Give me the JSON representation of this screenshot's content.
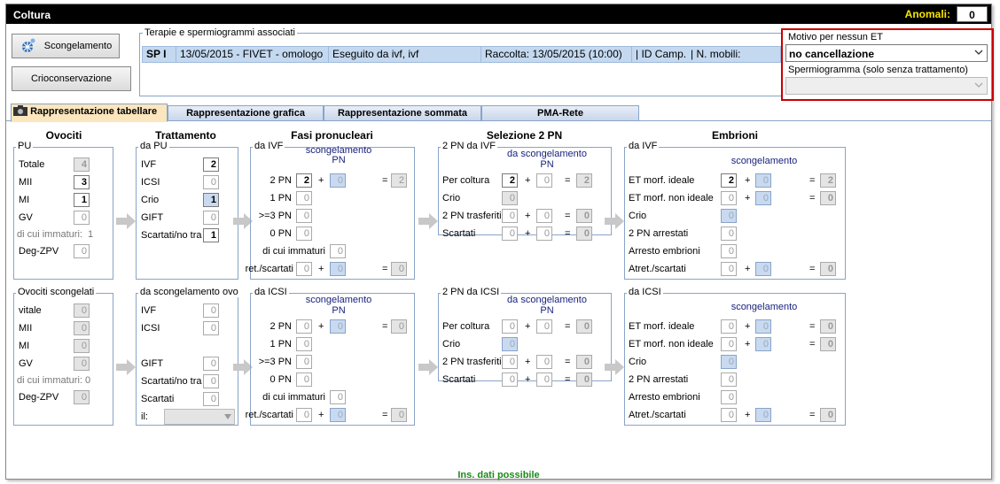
{
  "window": {
    "title": "Coltura",
    "anomali_label": "Anomali:",
    "anomali_value": "0"
  },
  "buttons": {
    "scongelamento": "Scongelamento",
    "crioconservazione": "Crioconservazione"
  },
  "terapie": {
    "legend": "Terapie e spermiogrammi associati",
    "row": [
      "SP I",
      "13/05/2015 - FIVET - omologo",
      "Eseguito da ivf, ivf",
      "Raccolta: 13/05/2015 (10:00)",
      "| ID Camp.:",
      "| N. mobili:"
    ]
  },
  "motivo": {
    "label": "Motivo per nessun ET",
    "value": "no cancellazione",
    "sperm_label": "Spermiogramma (solo senza trattamento)",
    "sperm_value": ""
  },
  "tabs": [
    "Rappresentazione tabellare",
    "Rappresentazione grafica",
    "Rappresentazione sommata",
    "PMA-Rete"
  ],
  "headers": {
    "ovociti": "Ovociti",
    "trattamento": "Trattamento",
    "fasi": "Fasi pronucleari",
    "selezione": "Selezione 2 PN",
    "embrioni": "Embrioni"
  },
  "top": {
    "pu": {
      "title": "PU",
      "rows": [
        {
          "l": "Totale",
          "v": "4"
        },
        {
          "l": "MII",
          "v": "3"
        },
        {
          "l": "MI",
          "v": "1"
        },
        {
          "l": "GV",
          "v": "0"
        }
      ],
      "immaturi": "di cui immaturi:",
      "immaturi_v": "1",
      "deg": "Deg-ZPV",
      "deg_v": "0"
    },
    "tratt": {
      "title": "da PU",
      "rows": [
        {
          "l": "IVF",
          "v": "2"
        },
        {
          "l": "ICSI",
          "v": "0"
        },
        {
          "l": "Crio",
          "v": "1"
        },
        {
          "l": "GIFT",
          "v": "0"
        },
        {
          "l": "Scartati/no tra",
          "v": "1"
        }
      ]
    },
    "fasi": {
      "title": "da IVF",
      "sub": "scongelamento",
      "sub2": "PN",
      "rows": [
        {
          "l": "2 PN",
          "v": "2",
          "s": "0",
          "t": "2"
        },
        {
          "l": "1 PN",
          "v": "0"
        },
        {
          "l": ">=3 PN",
          "v": "0"
        },
        {
          "l": "0 PN",
          "v": "0"
        }
      ],
      "imm": "di cui immaturi",
      "imm_v": "0",
      "atr": "Atret./scartati",
      "atr_v": "0",
      "atr_s": "0",
      "atr_t": "0"
    },
    "sel": {
      "title": "2 PN da IVF",
      "sub": "da scongelamento",
      "sub2": "PN",
      "rows": [
        {
          "l": "Per coltura",
          "v": "2",
          "s": "0",
          "t": "2"
        },
        {
          "l": "Crio",
          "v": "0"
        },
        {
          "l": "2 PN trasferiti",
          "v": "0",
          "s": "0",
          "t": "0"
        },
        {
          "l": "Scartati",
          "v": "0",
          "s": "0",
          "t": "0"
        }
      ]
    },
    "emb": {
      "title": "da IVF",
      "sub": "scongelamento",
      "rows": [
        {
          "l": "ET morf. ideale",
          "v": "2",
          "s": "0",
          "t": "2"
        },
        {
          "l": "ET morf. non ideale",
          "v": "0",
          "s": "0",
          "t": "0"
        },
        {
          "l": "Crio",
          "v": "0"
        },
        {
          "l": "2 PN arrestati",
          "v": "0"
        },
        {
          "l": "Arresto embrioni",
          "v": "0"
        },
        {
          "l": "Atret./scartati",
          "v": "0",
          "s": "0",
          "t": "0"
        }
      ]
    }
  },
  "bottom": {
    "pu": {
      "title": "Ovociti scongelati",
      "rows": [
        {
          "l": "vitale",
          "v": "0"
        },
        {
          "l": "MII",
          "v": "0"
        },
        {
          "l": "MI",
          "v": "0"
        },
        {
          "l": "GV",
          "v": "0"
        }
      ],
      "immaturi": "di cui immaturi: 0",
      "deg": "Deg-ZPV",
      "deg_v": "0"
    },
    "tratt": {
      "title": "da scongelamento ovo",
      "rows": [
        {
          "l": "IVF",
          "v": "0"
        },
        {
          "l": "ICSI",
          "v": "0"
        },
        {
          "l": "GIFT",
          "v": "0"
        },
        {
          "l": "Scartati/no tra",
          "v": "0"
        },
        {
          "l": "Scartati",
          "v": "0"
        }
      ],
      "il": "il:"
    },
    "fasi": {
      "title": "da ICSI",
      "sub": "scongelamento",
      "sub2": "PN",
      "rows": [
        {
          "l": "2 PN",
          "v": "0",
          "s": "0",
          "t": "0"
        },
        {
          "l": "1 PN",
          "v": "0"
        },
        {
          "l": ">=3 PN",
          "v": "0"
        },
        {
          "l": "0 PN",
          "v": "0"
        }
      ],
      "imm": "di cui immaturi",
      "imm_v": "0",
      "atr": "Atret./scartati",
      "atr_v": "0",
      "atr_s": "0",
      "atr_t": "0"
    },
    "sel": {
      "title": "2 PN da ICSI",
      "sub": "da scongelamento",
      "sub2": "PN",
      "rows": [
        {
          "l": "Per coltura",
          "v": "0",
          "s": "0",
          "t": "0"
        },
        {
          "l": "Crio",
          "v": "0"
        },
        {
          "l": "2 PN trasferiti",
          "v": "0",
          "s": "0",
          "t": "0"
        },
        {
          "l": "Scartati",
          "v": "0",
          "s": "0",
          "t": "0"
        }
      ]
    },
    "emb": {
      "title": "da ICSI",
      "sub": "scongelamento",
      "rows": [
        {
          "l": "ET morf. ideale",
          "v": "0",
          "s": "0",
          "t": "0"
        },
        {
          "l": "ET morf. non ideale",
          "v": "0",
          "s": "0",
          "t": "0"
        },
        {
          "l": "Crio",
          "v": "0"
        },
        {
          "l": "2 PN arrestati",
          "v": "0"
        },
        {
          "l": "Arresto embrioni",
          "v": "0"
        },
        {
          "l": "Atret./scartati",
          "v": "0",
          "s": "0",
          "t": "0"
        }
      ]
    }
  },
  "footer": "Ins. dati possibile"
}
